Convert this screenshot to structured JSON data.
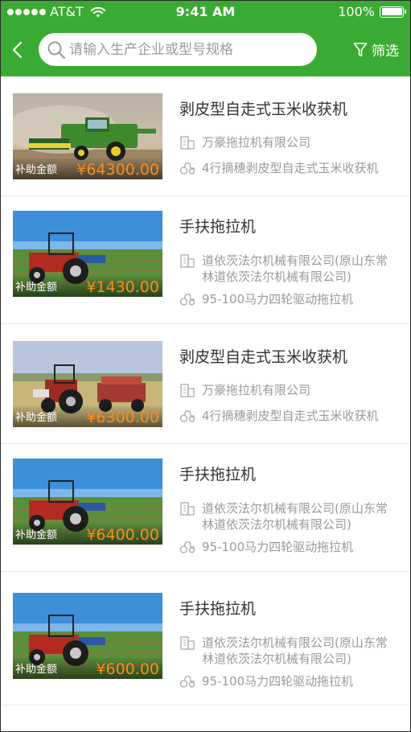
{
  "status_bar": {
    "carrier": "AT&T",
    "time": "9:41 AM",
    "battery": "100%"
  },
  "header": {
    "search_placeholder": "请输入生产企业或型号规格",
    "filter_label": "筛选"
  },
  "subsidy_label": "补助金额",
  "items": [
    {
      "title": "剥皮型自走式玉米收获机",
      "company": "万豪拖拉机有限公司",
      "spec": "4行摘穗剥皮型自走式玉米收获机",
      "amount": "¥64300.00",
      "image": "combine-harvester"
    },
    {
      "title": "手扶拖拉机",
      "company": "道依茨法尔机械有限公司(原山东常林道依茨法尔机械有限公司)",
      "spec": "95-100马力四轮驱动拖拉机",
      "amount": "¥1430.00",
      "image": "tractor-field"
    },
    {
      "title": "剥皮型自走式玉米收获机",
      "company": "万豪拖拉机有限公司",
      "spec": "4行摘穗剥皮型自走式玉米收获机",
      "amount": "¥6300.00",
      "image": "tractor-trailer"
    },
    {
      "title": "手扶拖拉机",
      "company": "道依茨法尔机械有限公司(原山东常林道依茨法尔机械有限公司)",
      "spec": "95-100马力四轮驱动拖拉机",
      "amount": "¥6400.00",
      "image": "tractor-field"
    },
    {
      "title": "手扶拖拉机",
      "company": "道依茨法尔机械有限公司(原山东常林道依茨法尔机械有限公司)",
      "spec": "95-100马力四轮驱动拖拉机",
      "amount": "¥600.00",
      "image": "tractor-field"
    }
  ],
  "colors": {
    "brand_green": "#3aab32",
    "amount_orange": "#ff8c1a"
  }
}
